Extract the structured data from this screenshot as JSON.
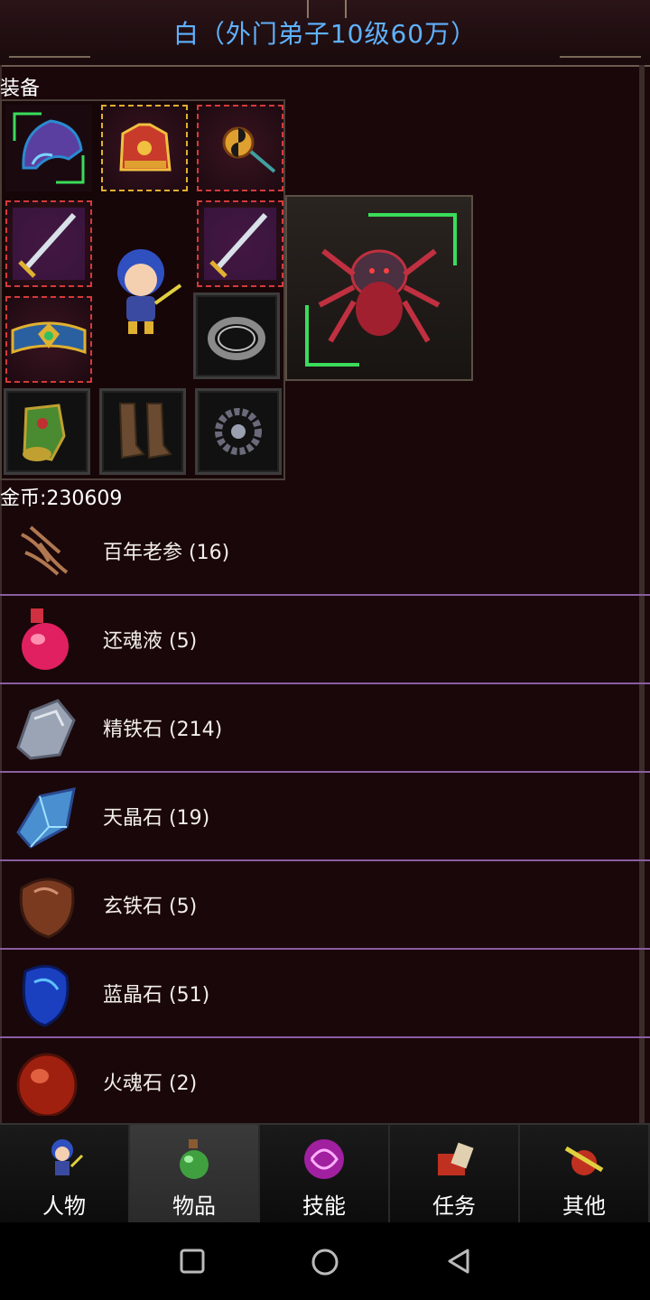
{
  "header": {
    "title": "白（外门弟子10级60万）"
  },
  "equipment": {
    "label": "装备",
    "slots": [
      "helmet",
      "armor",
      "amulet",
      "weapon-left",
      "weapon-right",
      "belt",
      "ring",
      "bracer",
      "boots",
      "bead-necklace"
    ]
  },
  "gold": {
    "text": "金币:230609"
  },
  "items": [
    {
      "label": "百年老参 (16)",
      "icon": "ginseng-icon"
    },
    {
      "label": "还魂液 (5)",
      "icon": "potion-icon"
    },
    {
      "label": "精铁石 (214)",
      "icon": "iron-ore-icon"
    },
    {
      "label": "天晶石 (19)",
      "icon": "sky-crystal-icon"
    },
    {
      "label": "玄铁石 (5)",
      "icon": "dark-iron-icon"
    },
    {
      "label": "蓝晶石 (51)",
      "icon": "blue-crystal-icon"
    },
    {
      "label": "火魂石 (2)",
      "icon": "fire-soul-icon"
    }
  ],
  "nav": [
    {
      "label": "人物",
      "icon": "character-icon",
      "active": false
    },
    {
      "label": "物品",
      "icon": "items-icon",
      "active": true
    },
    {
      "label": "技能",
      "icon": "skills-icon",
      "active": false
    },
    {
      "label": "任务",
      "icon": "quests-icon",
      "active": false
    },
    {
      "label": "其他",
      "icon": "other-icon",
      "active": false
    }
  ],
  "colors": {
    "title": "#5fb2ff",
    "divider": "#8a5ea0",
    "background": "#1a0709"
  }
}
